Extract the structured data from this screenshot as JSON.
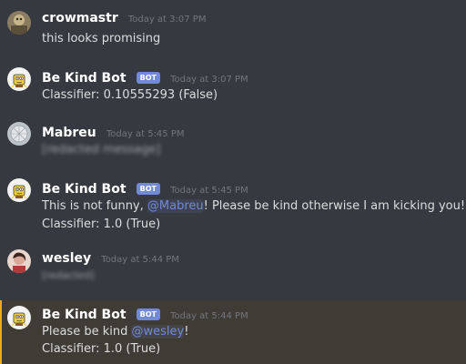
{
  "messages": [
    {
      "username": "crowmastr",
      "timestamp": "Today at 3:07 PM",
      "lines": [
        "this looks promising"
      ]
    },
    {
      "username": "Be Kind Bot",
      "bot_tag": "BOT",
      "timestamp": "Today at 3:07 PM",
      "lines": [
        "Classifier: 0.10555293 (False)"
      ]
    },
    {
      "username": "Mabreu",
      "timestamp": "Today at 5:45 PM",
      "lines": [
        "[redacted message]"
      ]
    },
    {
      "username": "Be Kind Bot",
      "bot_tag": "BOT",
      "timestamp": "Today at 5:45 PM",
      "line1_pre": "This is not funny, ",
      "line1_mention": "@Mabreu",
      "line1_post": "! Please be kind otherwise I am kicking you!",
      "lines": [
        "Classifier: 1.0 (True)"
      ]
    },
    {
      "username": "wesley",
      "timestamp": "Today at 5:44 PM",
      "lines": [
        "[redacted]"
      ]
    },
    {
      "username": "Be Kind Bot",
      "bot_tag": "BOT",
      "timestamp": "Today at 5:44 PM",
      "line1_pre": "Please be kind ",
      "line1_mention": "@wesley",
      "line1_post": "!",
      "lines": [
        "Classifier: 1.0 (True)"
      ]
    }
  ],
  "colors": {
    "background": "#36393f",
    "highlight_bg": "#3f3c35",
    "highlight_bar": "#faa61a",
    "bot_tag": "#7289da",
    "mention": "#7289da"
  }
}
